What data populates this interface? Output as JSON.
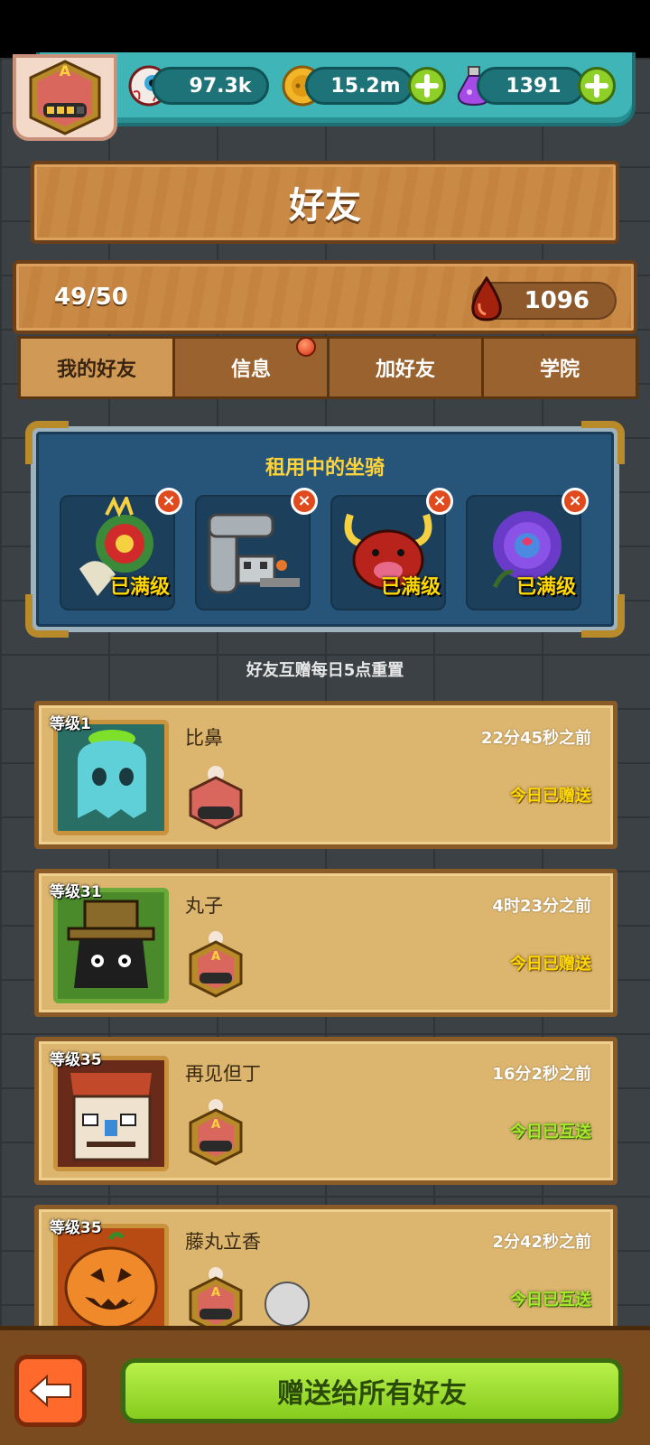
{
  "resources": {
    "eyes": "97.3k",
    "coins": "15.2m",
    "potions": "1391"
  },
  "colors": {
    "accent_green": "#86cc1e",
    "teal_bar": "#3fb5b8",
    "wood": "#c98a45",
    "gold_text": "#ffd800",
    "mutual_green": "#a6ea2a"
  },
  "page": {
    "title": "好友"
  },
  "summary": {
    "friend_count": "49/50",
    "blood": "1096"
  },
  "tabs": [
    {
      "label": "我的好友",
      "active": true
    },
    {
      "label": "信息",
      "active": false,
      "notification": true
    },
    {
      "label": "加好友",
      "active": false
    },
    {
      "label": "学院",
      "active": false
    }
  ],
  "mounts": {
    "title": "租用中的坐骑",
    "remove_symbol": "×",
    "slots": [
      {
        "badge": "已满级",
        "icon": "dragon-lion-icon"
      },
      {
        "badge": "",
        "icon": "robot-machine-icon"
      },
      {
        "badge": "已满级",
        "icon": "red-demon-icon"
      },
      {
        "badge": "已满级",
        "icon": "purple-rose-icon"
      }
    ]
  },
  "reset_note": "好友互赠每日5点重置",
  "friends": [
    {
      "level": "等级1",
      "name": "比鼻",
      "time": "22分45秒之前",
      "status": "今日已赠送",
      "mutual": false,
      "portrait": "ghost-icon"
    },
    {
      "level": "等级31",
      "name": "丸子",
      "time": "4时23分之前",
      "status": "今日已赠送",
      "mutual": false,
      "portrait": "hat-blob-icon"
    },
    {
      "level": "等级35",
      "name": "再见但丁",
      "time": "16分2秒之前",
      "status": "今日已互送",
      "mutual": true,
      "portrait": "zombie-face-icon"
    },
    {
      "level": "等级35",
      "name": "藤丸立香",
      "time": "2分42秒之前",
      "status": "今日已互送",
      "mutual": true,
      "portrait": "pumpkin-icon"
    }
  ],
  "bottom": {
    "gift_all_label": "赠送给所有好友"
  }
}
